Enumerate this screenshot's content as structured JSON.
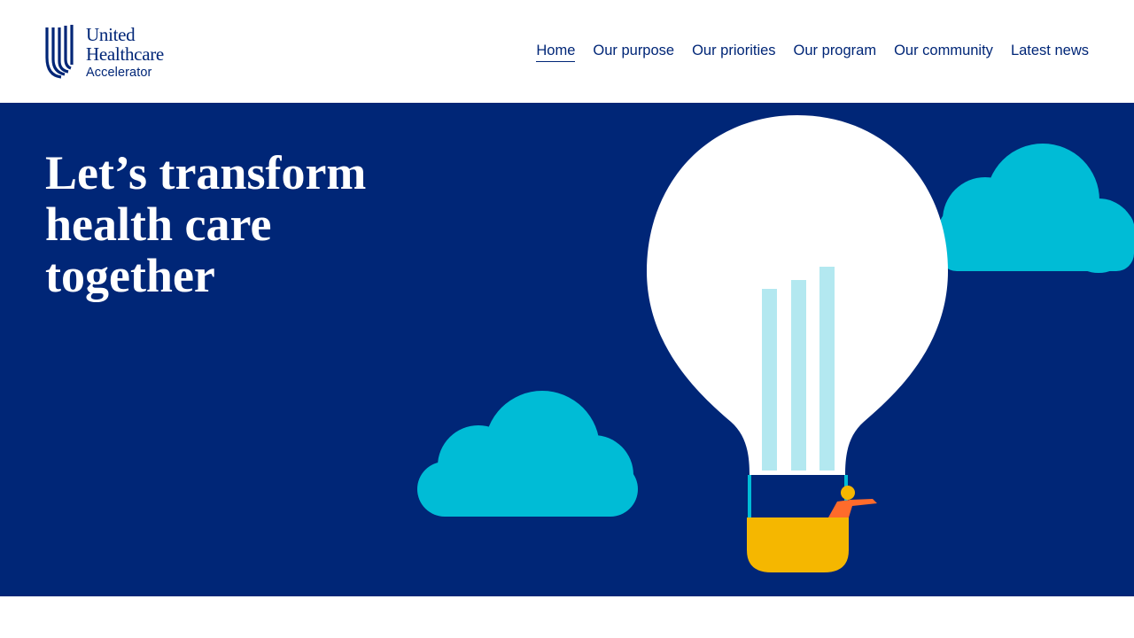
{
  "brand": {
    "line1": "United",
    "line2": "Healthcare",
    "line3": "Accelerator",
    "color": "#002677"
  },
  "nav": {
    "items": [
      {
        "label": "Home",
        "active": true
      },
      {
        "label": "Our purpose"
      },
      {
        "label": "Our priorities"
      },
      {
        "label": "Our program"
      },
      {
        "label": "Our community"
      },
      {
        "label": "Latest news"
      }
    ]
  },
  "hero": {
    "headline_line1": "Let’s transform",
    "headline_line2": "health care",
    "headline_line3": "together",
    "background": "#002677",
    "illustration": "hot-air-balloon-lightbulb-icon",
    "colors": {
      "cloud": "#00bcd6",
      "bulb": "#ffffff",
      "basket": "#f5b700",
      "figure": "#ff6b2b"
    }
  }
}
